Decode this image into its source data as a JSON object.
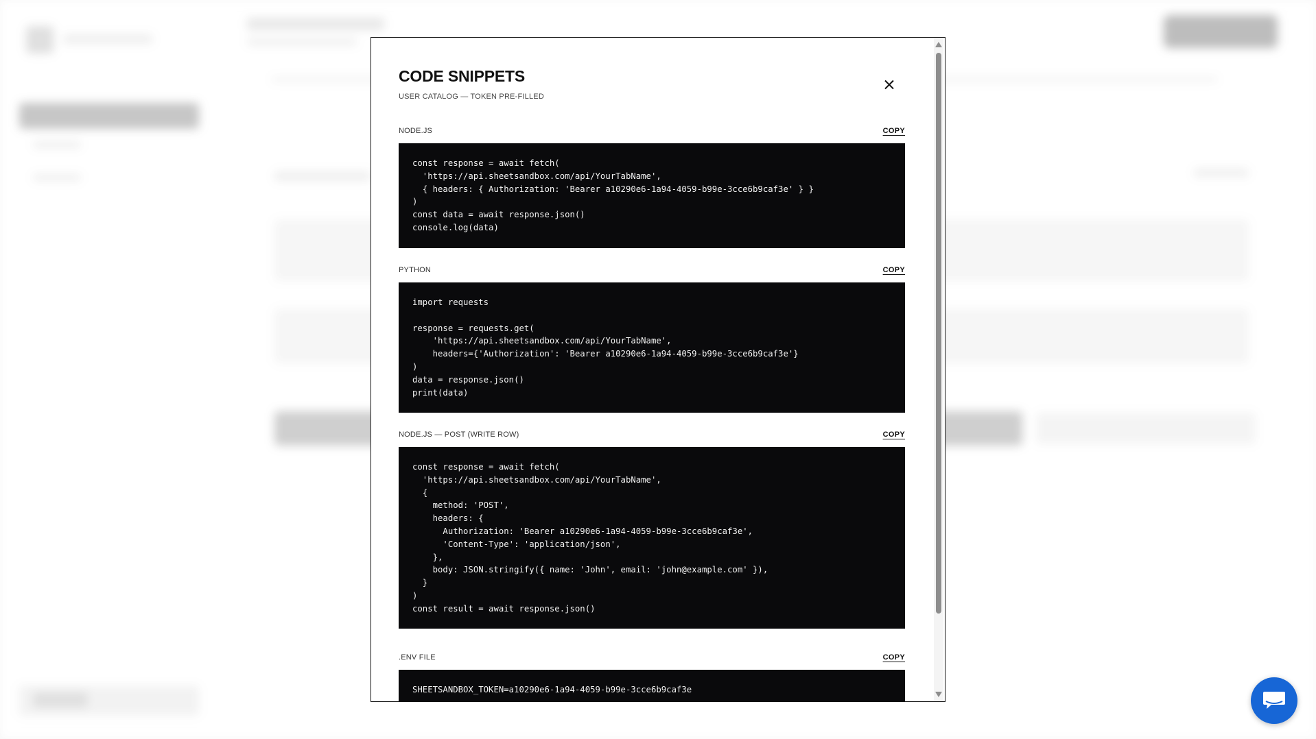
{
  "modal": {
    "title": "CODE SNIPPETS",
    "subtitle": "USER CATALOG — TOKEN PRE-FILLED",
    "snippets": [
      {
        "label": "NODE.JS",
        "copy_label": "COPY",
        "code": "const response = await fetch(\n  'https://api.sheetsandbox.com/api/YourTabName',\n  { headers: { Authorization: 'Bearer a10290e6-1a94-4059-b99e-3cce6b9caf3e' } }\n)\nconst data = await response.json()\nconsole.log(data)"
      },
      {
        "label": "PYTHON",
        "copy_label": "COPY",
        "code": "import requests\n\nresponse = requests.get(\n    'https://api.sheetsandbox.com/api/YourTabName',\n    headers={'Authorization': 'Bearer a10290e6-1a94-4059-b99e-3cce6b9caf3e'}\n)\ndata = response.json()\nprint(data)"
      },
      {
        "label": "NODE.JS — POST (WRITE ROW)",
        "copy_label": "COPY",
        "code": "const response = await fetch(\n  'https://api.sheetsandbox.com/api/YourTabName',\n  {\n    method: 'POST',\n    headers: {\n      Authorization: 'Bearer a10290e6-1a94-4059-b99e-3cce6b9caf3e',\n      'Content-Type': 'application/json',\n    },\n    body: JSON.stringify({ name: 'John', email: 'john@example.com' }),\n  }\n)\nconst result = await response.json()"
      },
      {
        "label": ".ENV FILE",
        "copy_label": "COPY",
        "code": "SHEETSANDBOX_TOKEN=a10290e6-1a94-4059-b99e-3cce6b9caf3e"
      }
    ]
  },
  "colors": {
    "code_background": "#0a0a0c",
    "chat_button": "#1766d6"
  },
  "icons": {
    "close": "close-icon",
    "chat": "chat-bubble-icon"
  }
}
